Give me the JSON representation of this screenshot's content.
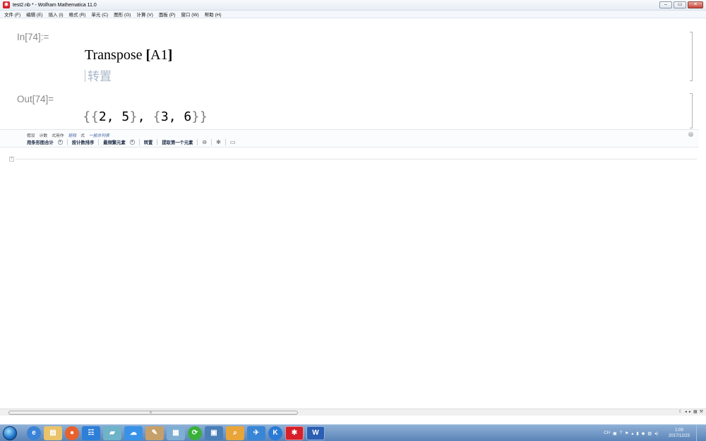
{
  "window": {
    "title": "test2.nb * - Wolfram Mathematica 11.0",
    "controls": [
      "–",
      "▭",
      "✕"
    ]
  },
  "menu": [
    "文件 (F)",
    "编辑 (E)",
    "插入 (I)",
    "格式 (R)",
    "单元 (C)",
    "图形 (G)",
    "计算 (V)",
    "面板 (P)",
    "窗口 (W)",
    "帮助 (H)"
  ],
  "notebook": {
    "in_label": "In[74]:=",
    "out_label": "Out[74]=",
    "input_fn": "Transpose",
    "input_open": "[",
    "input_arg": "A1",
    "input_close": "]",
    "hint": "转置",
    "output": {
      "o1": "{",
      "o2": "{",
      "a": "2, 5",
      "c1": "}",
      "comma": ", ",
      "o3": "{",
      "b": "3, 6",
      "c2": "}",
      "c3": "}"
    }
  },
  "suggestions": {
    "row1": [
      "假设",
      "计数",
      "式用作",
      "矩阵",
      "式",
      "一般并列表"
    ],
    "row2": {
      "b1": "用条形图合计",
      "b2": "按计数排序",
      "b3": "最频繁元素",
      "b4": "转置",
      "b5": "提取第一个元素"
    }
  },
  "taskbar": {
    "clock_time": "1:09",
    "clock_date": "2017/12/23",
    "tray_lang": "CH",
    "icons": [
      "browser-e",
      "files",
      "firefox",
      "app-grid",
      "notepad",
      "baidu-cloud",
      "paint",
      "calculator",
      "360",
      "network",
      "search",
      "plane",
      "k-app",
      "mathematica",
      "word"
    ]
  },
  "colors": {
    "label_gray": "#8a8a8a",
    "hint_blue_gray": "#a9b7c9",
    "taskbar_blue": "#5a84b8",
    "mathematica_red": "#d6202a"
  }
}
